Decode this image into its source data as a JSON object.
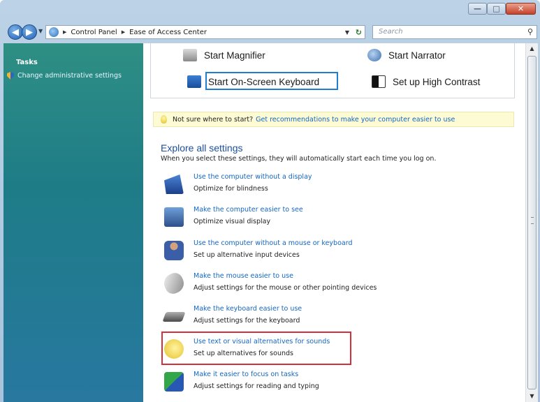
{
  "window": {
    "controls": {
      "minimize": "—",
      "maximize": "□",
      "close": "✕"
    }
  },
  "nav": {
    "back": "◀",
    "forward": "▶",
    "breadcrumbs": [
      "Control Panel",
      "Ease of Access Center"
    ],
    "search_placeholder": "Search"
  },
  "sidebar": {
    "heading": "Tasks",
    "items": [
      {
        "label": "Change administrative settings",
        "icon": "shield-icon"
      }
    ]
  },
  "quick_access": {
    "items": [
      {
        "label": "Start Magnifier",
        "icon": "magnifier-icon"
      },
      {
        "label": "Start Narrator",
        "icon": "narrator-icon"
      },
      {
        "label": "Start On-Screen Keyboard",
        "icon": "keyboard-icon"
      },
      {
        "label": "Set up High Contrast",
        "icon": "high-contrast-icon"
      }
    ]
  },
  "tip": {
    "question": "Not sure where to start?",
    "link": "Get recommendations to make your computer easier to use"
  },
  "explore": {
    "title": "Explore all settings",
    "description": "When you select these settings, they will automatically start each time you log on.",
    "options": [
      {
        "link": "Use the computer without a display",
        "desc": "Optimize for blindness",
        "icon": "display-icon"
      },
      {
        "link": "Make the computer easier to see",
        "desc": "Optimize visual display",
        "icon": "visual-display-icon"
      },
      {
        "link": "Use the computer without a mouse or keyboard",
        "desc": "Set up alternative input devices",
        "icon": "person-icon"
      },
      {
        "link": "Make the mouse easier to use",
        "desc": "Adjust settings for the mouse or other pointing devices",
        "icon": "mouse-icon"
      },
      {
        "link": "Make the keyboard easier to use",
        "desc": "Adjust settings for the keyboard",
        "icon": "keyboard-icon"
      },
      {
        "link": "Use text or visual alternatives for sounds",
        "desc": "Set up alternatives for sounds",
        "icon": "speech-bubble-icon"
      },
      {
        "link": "Make it easier to focus on tasks",
        "desc": "Adjust settings for reading and typing",
        "icon": "focus-icon"
      }
    ]
  },
  "colors": {
    "link": "#1466c1",
    "sidebar": "#1e7c87",
    "highlight": "#d0313a"
  }
}
